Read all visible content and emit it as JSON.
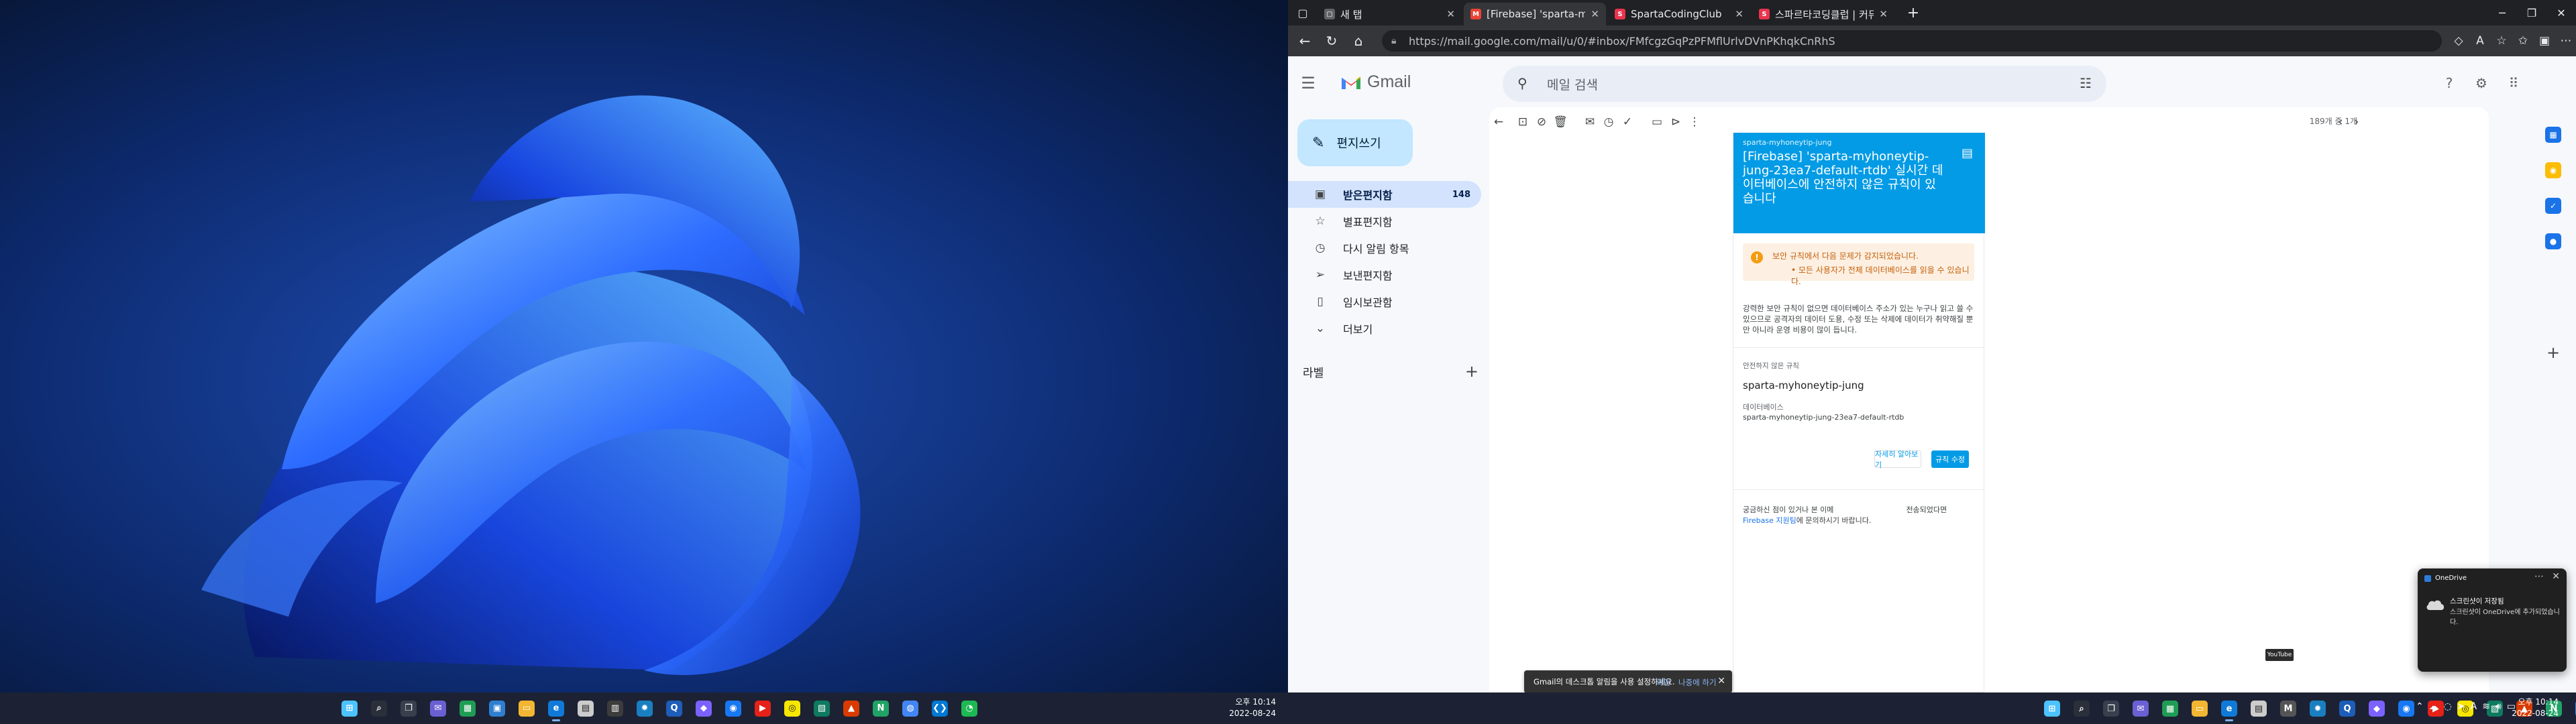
{
  "left_screen": {
    "taskbar": {
      "apps": [
        {
          "icon": "windows-start-icon",
          "glyph": "⊞",
          "color": "#4cc2ff"
        },
        {
          "icon": "search-icon",
          "glyph": "⌕",
          "color": "#2b2f3a"
        },
        {
          "icon": "task-view-icon",
          "glyph": "❐",
          "color": "#3a3f4d"
        },
        {
          "icon": "chat-icon",
          "glyph": "✉",
          "color": "#6b5fd3"
        },
        {
          "icon": "spreadsheet-icon",
          "glyph": "▦",
          "color": "#1f9d55"
        },
        {
          "icon": "photos-icon",
          "glyph": "▣",
          "color": "#2f7fd1"
        },
        {
          "icon": "file-explorer-icon",
          "glyph": "▭",
          "color": "#f2b632"
        },
        {
          "icon": "edge-icon",
          "glyph": "e",
          "color": "#0f7ad8"
        },
        {
          "icon": "store-icon",
          "glyph": "▤",
          "color": "#cccccc"
        },
        {
          "icon": "calculator-icon",
          "glyph": "▥",
          "color": "#3c3c3c"
        },
        {
          "icon": "gear-app-icon",
          "glyph": "✹",
          "color": "#1a7fc1"
        },
        {
          "icon": "search-app-icon",
          "glyph": "Q",
          "color": "#1e5db8"
        },
        {
          "icon": "app-icon",
          "glyph": "◆",
          "color": "#7b61ff"
        },
        {
          "icon": "messenger-icon",
          "glyph": "◉",
          "color": "#1877f2"
        },
        {
          "icon": "youtube-icon",
          "glyph": "▶",
          "color": "#e62117"
        },
        {
          "icon": "kakao-icon",
          "glyph": "◎",
          "color": "#f7e600"
        },
        {
          "icon": "doc-icon",
          "glyph": "▧",
          "color": "#0e7a5f"
        },
        {
          "icon": "office-icon",
          "glyph": "▲",
          "color": "#d83b01"
        },
        {
          "icon": "notion-icon",
          "glyph": "N",
          "color": "#21a366"
        },
        {
          "icon": "chrome-icon",
          "glyph": "◍",
          "color": "#4285f4"
        },
        {
          "icon": "vscode-icon",
          "glyph": "❮❯",
          "color": "#0078d4"
        },
        {
          "icon": "spotify-icon",
          "glyph": "◔",
          "color": "#1db954"
        }
      ],
      "time": "오후 10:14",
      "date": "2022-08-24"
    }
  },
  "right_screen": {
    "browser": {
      "tabs": [
        {
          "title": "새 탭",
          "favicon": "new-tab-icon",
          "fav_color": "#5f6368",
          "fav_glyph": "▢",
          "active": false
        },
        {
          "title": "[Firebase] 'sparta-myhoneytip-ju",
          "favicon": "gmail-icon",
          "fav_color": "#ea4335",
          "fav_glyph": "M",
          "active": true
        },
        {
          "title": "SpartaCodingClub",
          "favicon": "sparta-icon",
          "fav_color": "#e8344e",
          "fav_glyph": "S",
          "active": false
        },
        {
          "title": "스파르타코딩클럽 | 커뮤니티",
          "favicon": "sparta-community-icon",
          "fav_color": "#e8344e",
          "fav_glyph": "S",
          "active": false
        }
      ],
      "new_tab_label": "+",
      "url": "https://mail.google.com/mail/u/0/#inbox/FMfcgzGqPzPFMflUrlvDVnPKhqkCnRhS"
    },
    "gmail": {
      "brand": "Gmail",
      "search_placeholder": "메일 검색",
      "compose_label": "편지쓰기",
      "nav": [
        {
          "label": "받은편지함",
          "count": "148",
          "icon": "inbox-icon",
          "glyph": "▣",
          "active": true
        },
        {
          "label": "별표편지함",
          "count": "",
          "icon": "star-icon",
          "glyph": "☆",
          "active": false
        },
        {
          "label": "다시 알림 항목",
          "count": "",
          "icon": "clock-icon",
          "glyph": "◷",
          "active": false
        },
        {
          "label": "보낸편지함",
          "count": "",
          "icon": "send-icon",
          "glyph": "➢",
          "active": false
        },
        {
          "label": "임시보관함",
          "count": "",
          "icon": "draft-icon",
          "glyph": "▯",
          "active": false
        },
        {
          "label": "더보기",
          "count": "",
          "icon": "chevron-down-icon",
          "glyph": "⌄",
          "active": false
        }
      ],
      "labels_title": "라벨",
      "pager": "189개 중 1개",
      "email": {
        "project_small": "sparta-myhoneytip-jung",
        "subject": "[Firebase] 'sparta-myhoneytip-jung-23ea7-default-rtdb' 실시간 데이터베이스에 안전하지 않은 규칙이 있습니다",
        "warning_title": "보안 규칙에서 다음 문제가 감지되었습니다.",
        "warning_bullet": "• 모든 사용자가 전체 데이터베이스를 읽을 수 있습니다.",
        "description": "강력한 보안 규칙이 없으면 데이터베이스 주소가 있는 누구나 읽고 쓸 수 있으므로 공격자의 데이터 도용, 수정 또는 삭제에 데이터가 취약해질 뿐만 아니라 운영 비용이 많이 듭니다.",
        "unsafe_rules_label": "안전하지 않은 규칙",
        "rule_project": "sparta-myhoneytip-jung",
        "database_label": "데이터베이스",
        "database_value": "sparta-myhoneytip-jung-23ea7-default-rtdb",
        "learn_more_button": "자세히 알아보기",
        "edit_rules_button": "규칙 수정",
        "footer_prefix": "궁금하신 점이 있거나 본 이메",
        "footer_middle": "전송되었다면",
        "footer_link": "Firebase 지원팀",
        "footer_suffix": "에 문의하시기 바랍니다."
      },
      "snackbar": {
        "message": "Gmail의 데스크톱 알림을 사용 설정하세요.",
        "confirm": "확인",
        "later": "나중에 하기"
      }
    },
    "tooltip": "YouTube",
    "notification": {
      "app": "OneDrive",
      "title": "스크린샷이 저장됨",
      "message": "스크린샷이 OneDrive에 추가되었습니다."
    },
    "taskbar": {
      "apps": [
        {
          "icon": "windows-start-icon",
          "glyph": "⊞",
          "color": "#4cc2ff"
        },
        {
          "icon": "search-icon",
          "glyph": "⌕",
          "color": "#2b2f3a"
        },
        {
          "icon": "task-view-icon",
          "glyph": "❐",
          "color": "#3a3f4d"
        },
        {
          "icon": "chat-icon",
          "glyph": "✉",
          "color": "#6b5fd3"
        },
        {
          "icon": "spreadsheet-icon",
          "glyph": "▦",
          "color": "#1f9d55"
        },
        {
          "icon": "file-explorer-icon",
          "glyph": "▭",
          "color": "#f2b632"
        },
        {
          "icon": "edge-icon",
          "glyph": "e",
          "color": "#0f7ad8"
        },
        {
          "icon": "store-icon",
          "glyph": "▤",
          "color": "#cccccc"
        },
        {
          "icon": "mail-app-icon",
          "glyph": "M",
          "color": "#555555"
        },
        {
          "icon": "gear-app-icon",
          "glyph": "✹",
          "color": "#1a7fc1"
        },
        {
          "icon": "search-app-icon",
          "glyph": "Q",
          "color": "#1e5db8"
        },
        {
          "icon": "app-icon",
          "glyph": "◆",
          "color": "#7b61ff"
        },
        {
          "icon": "messenger-icon",
          "glyph": "◉",
          "color": "#1877f2"
        },
        {
          "icon": "youtube-icon",
          "glyph": "▶",
          "color": "#e62117"
        },
        {
          "icon": "kakao-icon",
          "glyph": "◎",
          "color": "#f7e600"
        },
        {
          "icon": "doc-icon",
          "glyph": "▧",
          "color": "#0e7a5f"
        },
        {
          "icon": "office-icon",
          "glyph": "▲",
          "color": "#d83b01"
        },
        {
          "icon": "notion-icon",
          "glyph": "N",
          "color": "#21a366"
        },
        {
          "icon": "chrome-icon",
          "glyph": "◍",
          "color": "#4285f4"
        },
        {
          "icon": "vscode-icon",
          "glyph": "❮❯",
          "color": "#0078d4"
        },
        {
          "icon": "spotify-icon",
          "glyph": "◔",
          "color": "#1db954"
        }
      ],
      "time": "오후 10:14",
      "date": "2022-08-24"
    }
  },
  "colors": {
    "gmail_bg": "#f6f8fc",
    "compose_bg": "#c2e7ff",
    "nav_active": "#d3e3fd",
    "firebase_blue": "#039be5",
    "warning_bg": "#fdf0e2",
    "warning_text": "#c5600a",
    "taskbar": "#1c2233"
  }
}
